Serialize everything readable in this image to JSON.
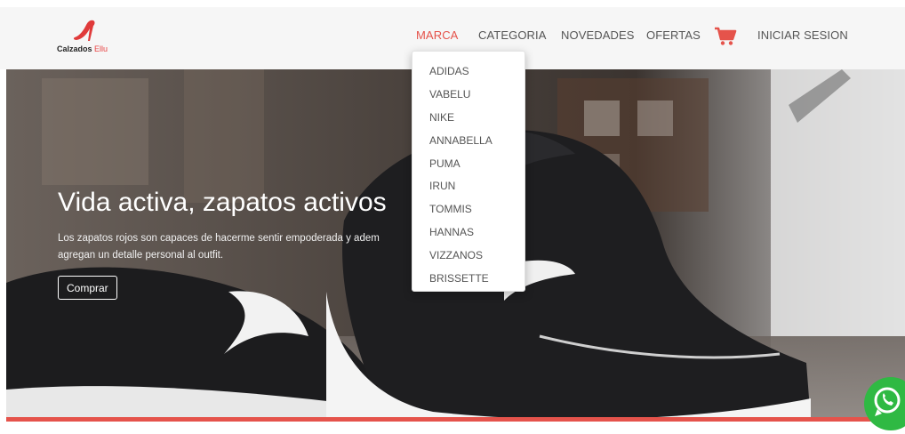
{
  "brand": {
    "name": "Calzados",
    "name_accent": "Ellu"
  },
  "nav": {
    "items": [
      {
        "label": "MARCA",
        "active": true
      },
      {
        "label": "CATEGORIA"
      },
      {
        "label": "NOVEDADES"
      },
      {
        "label": "OFERTAS"
      },
      {
        "label": "INICIAR SESION"
      }
    ],
    "cart_icon": "shopping-cart-icon"
  },
  "dropdown": {
    "items": [
      "ADIDAS",
      "VABELU",
      "NIKE",
      "ANNABELLA",
      "PUMA",
      "IRUN",
      "TOMMIS",
      "HANNAS",
      "VIZZANOS",
      "BRISSETTE"
    ]
  },
  "hero": {
    "title": "Vida activa, zapatos activos",
    "text_line1": "Los zapatos rojos son capaces de hacerme sentir empoderada y adem",
    "text_line2": "agregan un detalle personal al outfit.",
    "button": "Comprar"
  },
  "colors": {
    "accent": "#e5534b",
    "navbar_bg": "#f6f6f6",
    "whatsapp": "#2fb943"
  },
  "widgets": {
    "whatsapp_icon": "whatsapp-icon"
  }
}
